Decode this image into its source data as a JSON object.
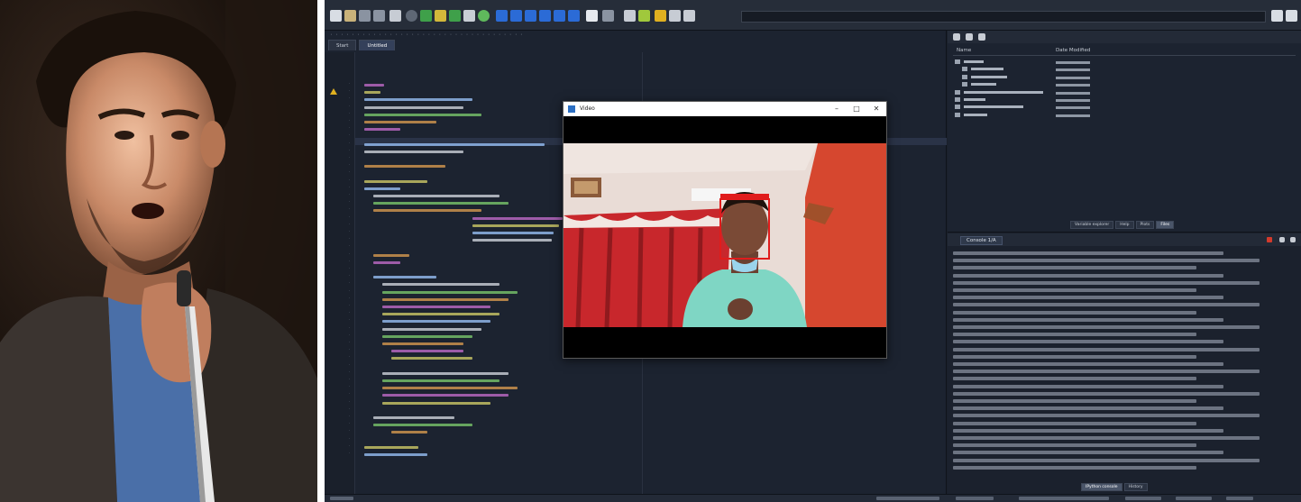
{
  "ide": {
    "tabs": [
      {
        "label": "Start"
      },
      {
        "label": "Untitled"
      }
    ],
    "files": {
      "col_name": "Name",
      "col_date": "Date Modified",
      "tabs": [
        {
          "label": "Variable explorer"
        },
        {
          "label": "Help"
        },
        {
          "label": "Plots"
        },
        {
          "label": "Files"
        }
      ]
    },
    "console": {
      "tab": "Console 1/A",
      "tabs": [
        {
          "label": "IPython console"
        },
        {
          "label": "History"
        }
      ]
    },
    "video_window": {
      "title": "Video"
    }
  },
  "colors": {
    "ide_bg": "#1a202b",
    "face_box": "#e01c1c",
    "wall_orange": "#d6472f",
    "curtain_red": "#c8272c",
    "shirt": "#7fd6c4"
  }
}
